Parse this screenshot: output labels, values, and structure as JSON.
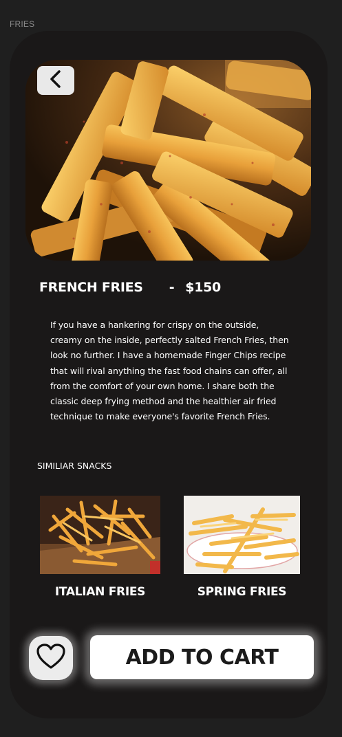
{
  "frame": {
    "label": "FRIES"
  },
  "product": {
    "name": "FRENCH FRIES",
    "separator": "-",
    "price": "$150",
    "description": "If you have a hankering for crispy on the outside, creamy on the inside, perfectly salted French Fries, then look no further. I have a homemade Finger Chips recipe that will rival anything the fast food chains can offer, all from the comfort of your own home. I share both the classic deep frying method and the healthier air fried technique to make everyone's favorite French Fries."
  },
  "similar": {
    "heading": "SIMILIAR SNACKS",
    "items": [
      {
        "label": "ITALIAN FRIES"
      },
      {
        "label": "SPRING FRIES"
      }
    ]
  },
  "actions": {
    "add_to_cart_label": "ADD TO CART",
    "favorite_icon": "heart-icon",
    "back_icon": "chevron-left-icon"
  },
  "colors": {
    "background": "#1f1f1f",
    "card": "#1a1818",
    "accent": "#ffffff"
  }
}
